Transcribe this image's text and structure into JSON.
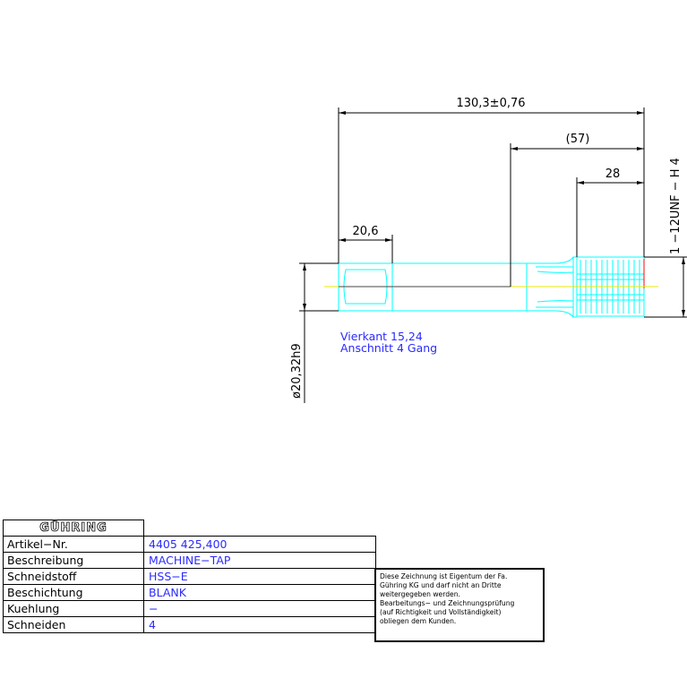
{
  "dimensions": {
    "overall_length": "130,3±0,76",
    "thread_length": "(57)",
    "short_length": "28",
    "square_length": "20,6",
    "shank_diameter": "ø20,32h9",
    "thread_spec": "1 −12UNF − H 4"
  },
  "notes": {
    "line1": "Vierkant 15,24",
    "line2": "Anschnitt 4 Gang"
  },
  "title_block": {
    "logo": "GÜHRING",
    "rows": [
      {
        "label": "Artikel−Nr.",
        "value": "4405 425,400"
      },
      {
        "label": "Beschreibung",
        "value": "MACHINE−TAP"
      },
      {
        "label": "Schneidstoff",
        "value": "HSS−E"
      },
      {
        "label": "Beschichtung",
        "value": "BLANK"
      },
      {
        "label": "Kuehlung",
        "value": "−"
      },
      {
        "label": "Schneiden",
        "value": "4"
      }
    ]
  },
  "notice": {
    "line1": "Diese Zeichnung ist Eigentum der Fa.",
    "line2": "Gühring KG und darf nicht an Dritte",
    "line3": "weitergegeben werden.",
    "line4": "Bearbeitungs− und Zeichnungsprüfung",
    "line5": "(auf Richtigkeit und Vollständigkeit)",
    "line6": "obliegen dem Kunden."
  },
  "colors": {
    "outline": "#00ffff",
    "centerline": "#ffff00",
    "dimension": "#000000",
    "text_blue": "#2b2bff",
    "edge_red": "#ff0000"
  }
}
